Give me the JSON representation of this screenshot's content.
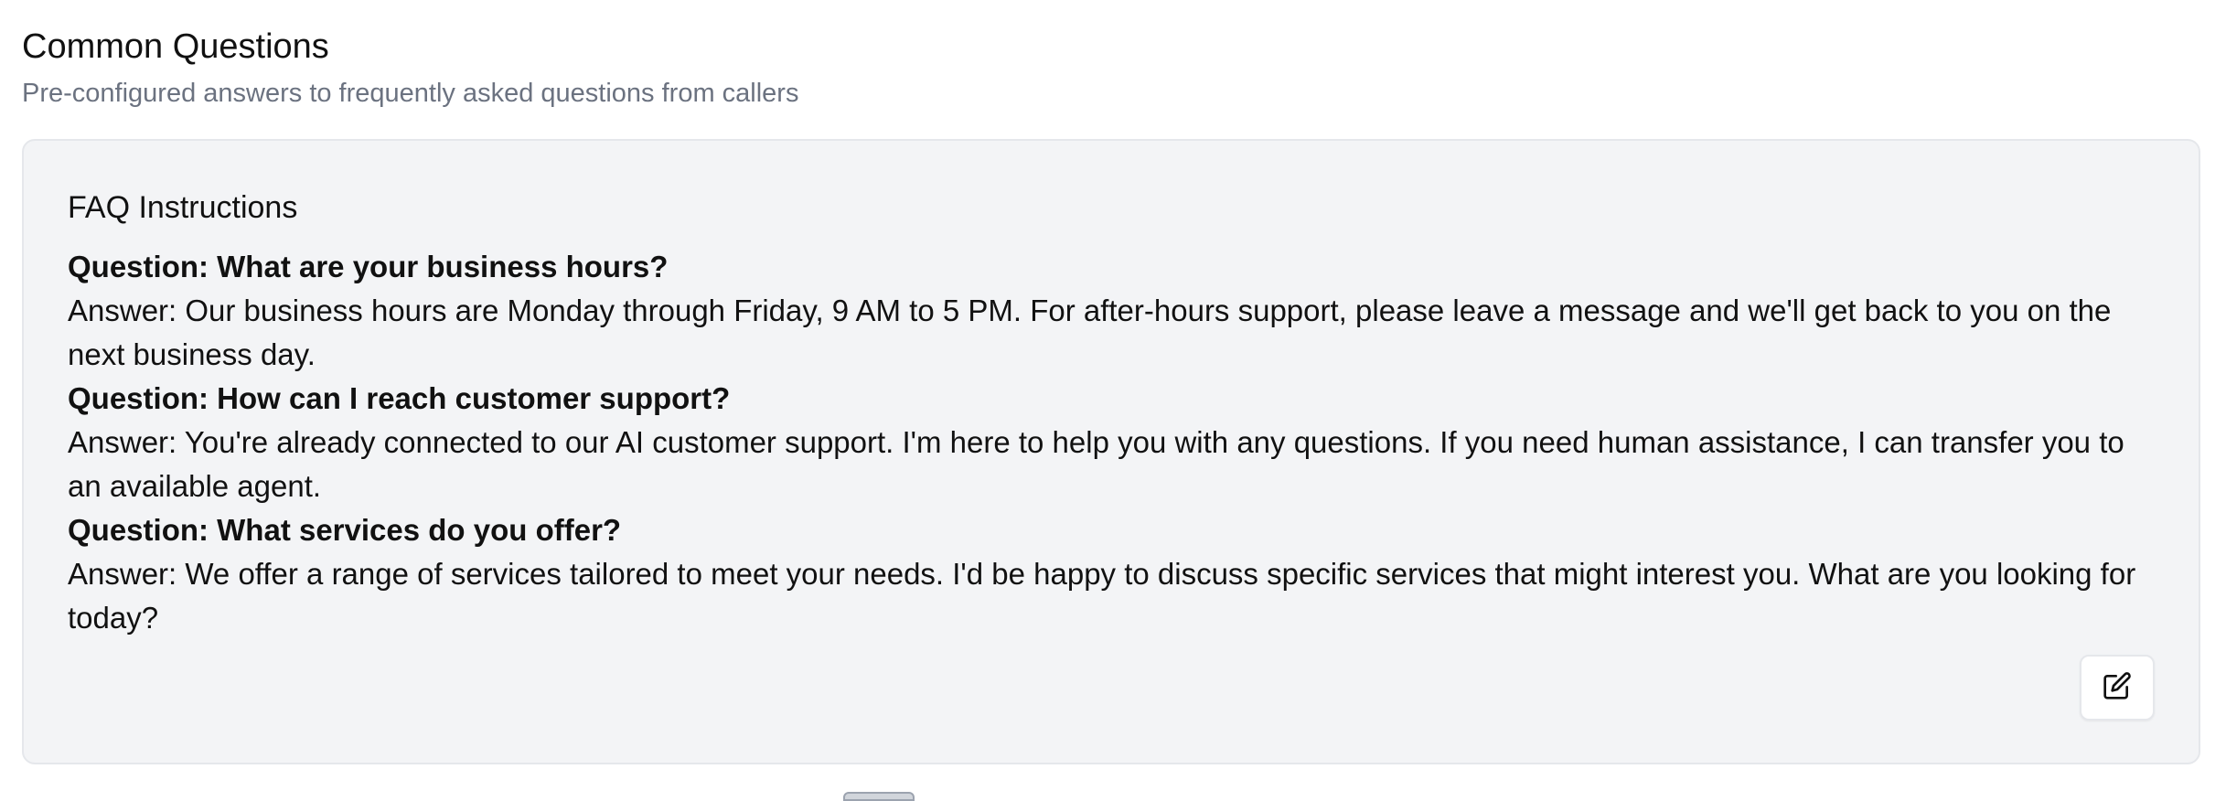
{
  "section": {
    "title": "Common Questions",
    "subtitle": "Pre-configured answers to frequently asked questions from callers"
  },
  "faq_card": {
    "title": "FAQ Instructions",
    "items": [
      {
        "question": "Question: What are your business hours?",
        "answer": "Answer: Our business hours are Monday through Friday, 9 AM to 5 PM. For after-hours support, please leave a message and we'll get back to you on the next business day."
      },
      {
        "question": "Question: How can I reach customer support?",
        "answer": "Answer: You're already connected to our AI customer support. I'm here to help you with any questions. If you need human assistance, I can transfer you to an available agent."
      },
      {
        "question": "Question: What services do you offer?",
        "answer": "Answer: We offer a range of services tailored to meet your needs. I'd be happy to discuss specific services that might interest you. What are you looking for today?"
      }
    ],
    "edit_icon": "edit-icon"
  },
  "colors": {
    "card_background": "#f3f4f6",
    "card_border": "#e5e7eb",
    "subtitle_text": "#6b7280",
    "body_text": "#111111"
  }
}
